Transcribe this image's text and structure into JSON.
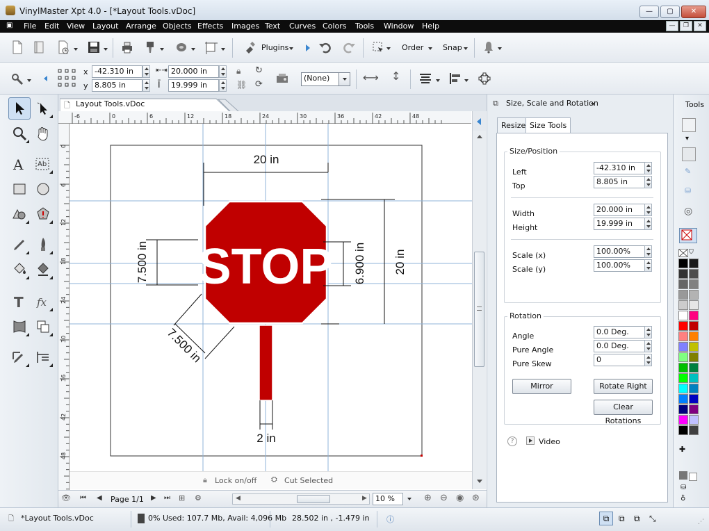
{
  "window": {
    "title": "VinylMaster Xpt 4.0 - [*Layout Tools.vDoc]"
  },
  "menu": [
    "File",
    "Edit",
    "View",
    "Layout",
    "Arrange",
    "Objects",
    "Effects",
    "Images",
    "Text",
    "Curves",
    "Colors",
    "Tools",
    "Window",
    "Help"
  ],
  "toolbar": {
    "plugins_label": "Plugins",
    "order_label": "Order",
    "snap_label": "Snap"
  },
  "propbar": {
    "x_label": "x",
    "y_label": "y",
    "x_value": "-42.310 in",
    "y_value": "8.805 in",
    "w_value": "20.000 in",
    "h_value": "19.999 in",
    "fill_select": "(None)"
  },
  "document": {
    "tab": "Layout Tools.vDoc",
    "ruler_h": [
      "-6",
      "0",
      "6",
      "12",
      "18",
      "24",
      "30",
      "36",
      "42",
      "48"
    ],
    "ruler_v": [
      "0",
      "6",
      "12",
      "18",
      "24",
      "30",
      "36",
      "42",
      "48"
    ],
    "sign_text": "STOP",
    "dims": {
      "top": "20 in",
      "left": "7.500 in",
      "inner": "6.900 in",
      "right": "20 in",
      "diag": "7.500 in",
      "bottom": "2 in"
    },
    "lock_label": "Lock on/off",
    "cut_label": "Cut Selected",
    "page_label": "Page 1/1",
    "zoom": "10 %"
  },
  "panel": {
    "title": "Size, Scale and Rotation",
    "tools_label": "Tools",
    "tabs": [
      "Resize",
      "Size Tools"
    ],
    "size_group": "Size/Position",
    "left_label": "Left",
    "left_value": "-42.310 in",
    "top_label": "Top",
    "top_value": "8.805 in",
    "width_label": "Width",
    "width_value": "20.000 in",
    "height_label": "Height",
    "height_value": "19.999 in",
    "scalex_label": "Scale (x)",
    "scalex_value": "100.00%",
    "scaley_label": "Scale (y)",
    "scaley_value": "100.00%",
    "rot_group": "Rotation",
    "angle_label": "Angle",
    "angle_value": "0.0 Deg.",
    "pure_angle_label": "Pure Angle",
    "pure_angle_value": "0.0 Deg.",
    "pure_skew_label": "Pure Skew",
    "pure_skew_value": "0",
    "mirror_btn": "Mirror",
    "rotate_right_btn": "Rotate Right",
    "clear_rot_btn": "Clear Rotations",
    "help_q": "?",
    "video_label": "Video"
  },
  "palette": [
    "#000000",
    "#1a1a1a",
    "#333333",
    "#4d4d4d",
    "#666666",
    "#808080",
    "#999999",
    "#b3b3b3",
    "#cccccc",
    "#e6e6e6",
    "#ffffff",
    "#ff0080",
    "#ff0000",
    "#c00000",
    "#ff8080",
    "#ff8000",
    "#8080ff",
    "#c0c000",
    "#80ff80",
    "#808000",
    "#00c000",
    "#008040",
    "#00ff00",
    "#00c0c0",
    "#00ffff",
    "#0080c0",
    "#0080ff",
    "#0000c0",
    "#000080",
    "#800080",
    "#ff00ff",
    "#c0c0ff",
    "#000000",
    "#404040"
  ],
  "status": {
    "file": "*Layout Tools.vDoc",
    "pct": "0%",
    "mem": "Used: 107.7 Mb, Avail: 4,096 Mb",
    "coords": "28.502 in , -1.479 in"
  }
}
